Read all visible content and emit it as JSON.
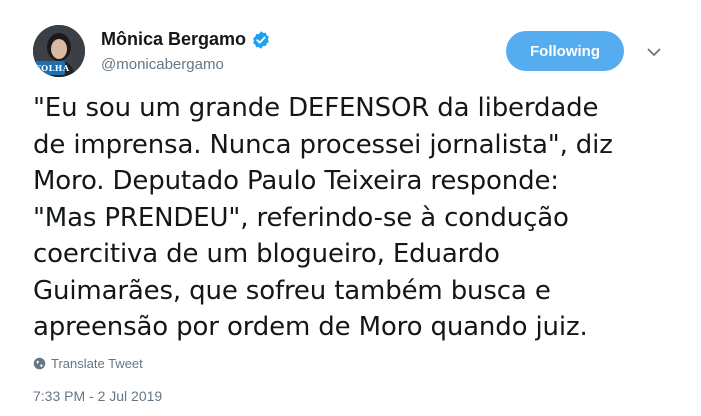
{
  "author": {
    "display_name": "Mônica Bergamo",
    "handle": "@monicabergamo",
    "badge": "FOLHA"
  },
  "follow_button": {
    "label": "Following"
  },
  "tweet": {
    "lines": [
      "\"Eu sou um grande DEFENSOR da liberdade",
      "de imprensa. Nunca processei jornalista\", diz",
      "Moro. Deputado Paulo Teixeira responde:",
      "\"Mas PRENDEU\", referindo-se à condução",
      "coercitiva de um blogueiro, Eduardo",
      "Guimarães, que sofreu também busca e",
      "apreensão por ordem de Moro quando juiz."
    ]
  },
  "translate_label": "Translate Tweet",
  "timestamp": "7:33 PM - 2 Jul 2019",
  "colors": {
    "accent": "#55acee",
    "verified": "#1da1f2",
    "secondary_text": "#657786"
  },
  "icons": {
    "verified": "verified-badge-icon",
    "caret": "chevron-down-icon",
    "translate": "globe-icon"
  }
}
